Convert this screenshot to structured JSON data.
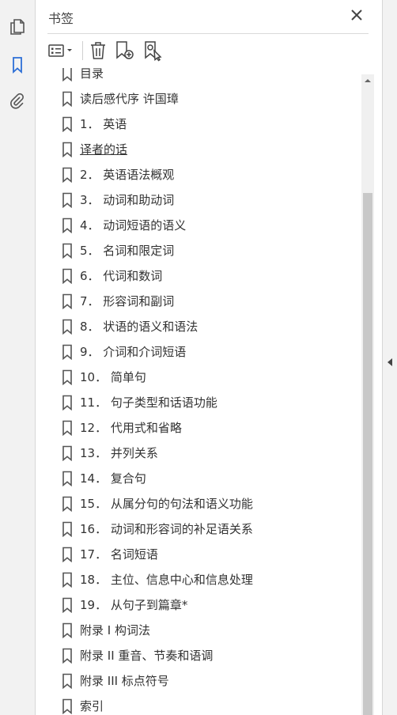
{
  "panel": {
    "title": "书签"
  },
  "colors": {
    "accent": "#2d6fd6",
    "icon": "#555555"
  },
  "left_rail": {
    "icons": [
      "pages-icon",
      "bookmark-icon",
      "attachment-icon"
    ],
    "active": "bookmark-icon"
  },
  "toolbar": {
    "icons": [
      "options-menu-icon",
      "delete-icon",
      "new-bookmark-icon",
      "new-bookmark-from-structure-icon"
    ]
  },
  "bookmarks": [
    {
      "label": "目录",
      "partially_visible": true
    },
    {
      "label": "读后感代序 许国璋"
    },
    {
      "label": "1． 英语"
    },
    {
      "label": "译者的话",
      "underlined": true
    },
    {
      "label": "2． 英语语法概观"
    },
    {
      "label": "3． 动词和助动词"
    },
    {
      "label": "4． 动词短语的语义"
    },
    {
      "label": "5． 名词和限定词"
    },
    {
      "label": "6． 代词和数词"
    },
    {
      "label": "7． 形容词和副词"
    },
    {
      "label": "8． 状语的语义和语法"
    },
    {
      "label": "9． 介词和介词短语"
    },
    {
      "label": "10． 简单句"
    },
    {
      "label": "11． 句子类型和话语功能"
    },
    {
      "label": "12． 代用式和省略"
    },
    {
      "label": "13． 并列关系"
    },
    {
      "label": "14． 复合句"
    },
    {
      "label": "15． 从属分句的句法和语义功能"
    },
    {
      "label": "16． 动词和形容词的补足语关系"
    },
    {
      "label": "17． 名词短语"
    },
    {
      "label": "18． 主位、信息中心和信息处理"
    },
    {
      "label": "19． 从句子到篇章*"
    },
    {
      "label": "附录 I 构词法"
    },
    {
      "label": "附录 II 重音、节奏和语调"
    },
    {
      "label": "附录 III 标点符号"
    },
    {
      "label": "索引"
    }
  ]
}
